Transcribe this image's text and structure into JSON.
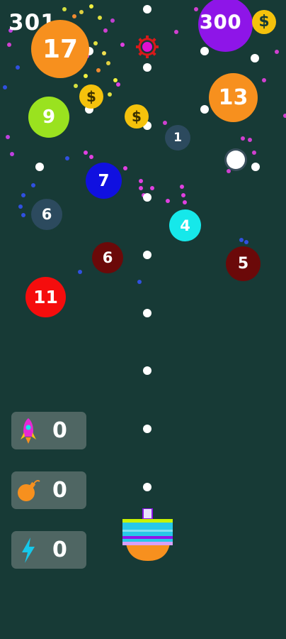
{
  "hud": {
    "score": "301",
    "coins": "300"
  },
  "balls": [
    {
      "label": "17",
      "color": "#f7901e"
    },
    {
      "label": "9",
      "color": "#9ae21f"
    },
    {
      "label": "7",
      "color": "#1010e0"
    },
    {
      "label": "6",
      "color": "#2c4a5e"
    },
    {
      "label": "6",
      "color": "#6b0909"
    },
    {
      "label": "11",
      "color": "#f50d0d"
    },
    {
      "label": "1",
      "color": "#2c4a5e"
    },
    {
      "label": "4",
      "color": "#16e8ea"
    },
    {
      "label": "13",
      "color": "#f7901e"
    },
    {
      "label": "5",
      "color": "#6b0909"
    },
    {
      "label": "",
      "color": "#8e15e8"
    }
  ],
  "powerups": [
    {
      "name": "rocket",
      "icon": "rocket-icon",
      "count": "0"
    },
    {
      "name": "bomb",
      "icon": "bomb-icon",
      "count": "0"
    },
    {
      "name": "lightning",
      "icon": "lightning-icon",
      "count": "0"
    }
  ],
  "coin_symbol": "$",
  "colors": {
    "background": "#173a36",
    "coin": "#f5c20c",
    "panel": "#4f6663",
    "cannon_top": "#28c8e8",
    "cannon_bottom": "#f7901e"
  }
}
